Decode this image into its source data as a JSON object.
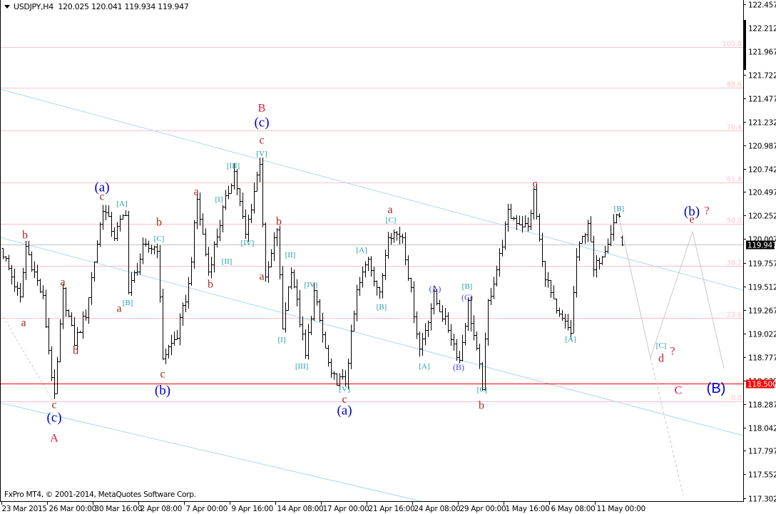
{
  "header": {
    "symbol": "USDJPY,H4",
    "open": "120.025",
    "high": "120.041",
    "low": "119.934",
    "close": "119.947"
  },
  "footer": {
    "copyright": "FxPro MT4, © 2001-2014, MetaQuotes Software Corp."
  },
  "colors": {
    "bars": "#000000",
    "fib": "#ffc0cb",
    "channel": "#add8e6",
    "hline": "#ff0000",
    "projection": "#c8c8c8",
    "wave_minor": "#a52a2a",
    "wave_bracket": "#20a0a0",
    "wave_paren": "#0000cd",
    "wave_major": "#dc143c",
    "wave_small_paren": "#4040ff"
  },
  "chart_data": {
    "type": "ohlc",
    "title": "USDJPY,H4",
    "ylim": [
      117.302,
      122.457
    ],
    "y_ticks": [
      "122.457",
      "122.212",
      "121.967",
      "121.722",
      "121.477",
      "121.232",
      "120.987",
      "120.742",
      "120.497",
      "120.252",
      "120.007",
      "119.757",
      "119.512",
      "119.267",
      "119.022",
      "118.777",
      "118.532",
      "118.287",
      "118.042",
      "117.797",
      "117.552",
      "117.302"
    ],
    "x_ticks": [
      "23 Mar 2015",
      "26 Mar 00:00",
      "30 Mar 16:00",
      "2 Apr 08:00",
      "7 Apr 00:00",
      "9 Apr 16:00",
      "14 Apr 08:00",
      "17 Apr 00:00",
      "21 Apr 16:00",
      "24 Apr 08:00",
      "29 Apr 00:00",
      "1 May 16:00",
      "6 May 08:00",
      "11 May 00:00"
    ],
    "bars_per_x_tick": 16,
    "swing_points": [
      [
        0,
        119.861
      ],
      [
        6,
        119.377
      ],
      [
        8,
        119.935
      ],
      [
        14,
        119.377
      ],
      [
        18,
        118.336
      ],
      [
        21,
        119.452
      ],
      [
        25,
        118.931
      ],
      [
        29,
        119.229
      ],
      [
        35,
        120.344
      ],
      [
        39,
        120.047
      ],
      [
        43,
        120.307
      ],
      [
        44,
        119.452
      ],
      [
        49,
        119.898
      ],
      [
        54,
        119.935
      ],
      [
        56,
        118.782
      ],
      [
        61,
        119.005
      ],
      [
        65,
        119.526
      ],
      [
        68,
        120.419
      ],
      [
        72,
        119.675
      ],
      [
        77,
        120.307
      ],
      [
        81,
        120.716
      ],
      [
        85,
        120.047
      ],
      [
        90,
        120.828
      ],
      [
        92,
        119.563
      ],
      [
        96,
        120.121
      ],
      [
        98,
        119.08
      ],
      [
        101,
        119.712
      ],
      [
        106,
        118.782
      ],
      [
        109,
        119.452
      ],
      [
        115,
        118.559
      ],
      [
        120,
        118.522
      ],
      [
        124,
        119.452
      ],
      [
        128,
        119.824
      ],
      [
        132,
        119.414
      ],
      [
        135,
        120.084
      ],
      [
        140,
        120.047
      ],
      [
        146,
        118.857
      ],
      [
        151,
        119.414
      ],
      [
        156,
        119.08
      ],
      [
        160,
        118.745
      ],
      [
        163,
        119.34
      ],
      [
        168,
        118.485
      ],
      [
        170,
        119.34
      ],
      [
        174,
        119.824
      ],
      [
        177,
        120.27
      ],
      [
        184,
        120.121
      ],
      [
        186,
        120.493
      ],
      [
        189,
        119.749
      ],
      [
        194,
        119.229
      ],
      [
        199,
        119.043
      ],
      [
        201,
        119.824
      ],
      [
        205,
        120.196
      ],
      [
        207,
        119.675
      ],
      [
        211,
        119.935
      ],
      [
        215,
        120.255
      ]
    ],
    "last_bar": {
      "open": 120.025,
      "high": 120.041,
      "low": 119.934,
      "close": 119.947
    },
    "current_price_label": "119.947",
    "horizontal_line": {
      "price": 118.5,
      "label": "118.500"
    },
    "fibonacci": {
      "price_0": 118.314,
      "price_100": 122.011,
      "levels": [
        "100.0",
        "88.6",
        "76.4",
        "61.8",
        "50.0",
        "38.2",
        "23.6",
        "0.0"
      ]
    },
    "projection_path": [
      [
        215.75,
        120.255
      ],
      [
        227,
        118.767
      ],
      [
        241.75,
        120.084
      ],
      [
        252.75,
        118.656
      ]
    ],
    "projection_dashed": [
      [
        227,
        118.767
      ],
      [
        238.5,
        117.332
      ]
    ],
    "annotations": [
      {
        "text": "a",
        "style": "minor",
        "bar": 7.25,
        "price": 119.139
      },
      {
        "text": "b",
        "style": "minor",
        "bar": 7.75,
        "price": 120.054
      },
      {
        "text": "a",
        "style": "minor",
        "bar": 21,
        "price": 119.563
      },
      {
        "text": "b",
        "style": "minor",
        "bar": 25.5,
        "price": 118.849
      },
      {
        "text": "c",
        "style": "minor",
        "bar": 18,
        "price": 118.284
      },
      {
        "text": "(c)",
        "style": "paren",
        "bar": 18,
        "price": 118.15
      },
      {
        "text": "A",
        "style": "major",
        "bar": 18,
        "price": 117.934
      },
      {
        "text": "(a)",
        "style": "paren",
        "bar": 34.75,
        "price": 120.553
      },
      {
        "text": "c",
        "style": "minor",
        "bar": 34.75,
        "price": 120.456
      },
      {
        "text": "[A]",
        "style": "bracket",
        "bar": 41.75,
        "price": 120.382
      },
      {
        "text": "a",
        "style": "minor",
        "bar": 40.75,
        "price": 119.288
      },
      {
        "text": "[B]",
        "style": "bracket",
        "bar": 43.75,
        "price": 119.348
      },
      {
        "text": "b",
        "style": "minor",
        "bar": 54.75,
        "price": 120.188
      },
      {
        "text": "[C]",
        "style": "bracket",
        "bar": 54.75,
        "price": 120.017
      },
      {
        "text": "c",
        "style": "minor",
        "bar": 56,
        "price": 118.604
      },
      {
        "text": "(b)",
        "style": "paren",
        "bar": 56,
        "price": 118.433
      },
      {
        "text": "a",
        "style": "minor",
        "bar": 67.75,
        "price": 120.508
      },
      {
        "text": "b",
        "style": "minor",
        "bar": 72.75,
        "price": 119.541
      },
      {
        "text": "[I]",
        "style": "bracket",
        "bar": 75.75,
        "price": 120.426
      },
      {
        "text": "[II]",
        "style": "bracket",
        "bar": 78.5,
        "price": 119.779
      },
      {
        "text": "[III]",
        "style": "bracket",
        "bar": 80.75,
        "price": 120.776
      },
      {
        "text": "[IV]",
        "style": "bracket",
        "bar": 85.75,
        "price": 119.972
      },
      {
        "text": "[V]",
        "style": "bracket",
        "bar": 90.75,
        "price": 120.902
      },
      {
        "text": "c",
        "style": "minor",
        "bar": 90.75,
        "price": 121.044
      },
      {
        "text": "(c)",
        "style": "paren",
        "bar": 90.75,
        "price": 121.23
      },
      {
        "text": "B",
        "style": "major",
        "bar": 90.75,
        "price": 121.378
      },
      {
        "text": "a",
        "style": "minor",
        "bar": 90.75,
        "price": 119.623
      },
      {
        "text": "b",
        "style": "minor",
        "bar": 96.75,
        "price": 120.196
      },
      {
        "text": "[II]",
        "style": "bracket",
        "bar": 100.75,
        "price": 119.846
      },
      {
        "text": "[I]",
        "style": "bracket",
        "bar": 97.75,
        "price": 118.961
      },
      {
        "text": "[IV]",
        "style": "bracket",
        "bar": 108,
        "price": 119.534
      },
      {
        "text": "[III]",
        "style": "bracket",
        "bar": 104.75,
        "price": 118.685
      },
      {
        "text": "[V]",
        "style": "bracket",
        "bar": 119.75,
        "price": 118.447
      },
      {
        "text": "c",
        "style": "minor",
        "bar": 119.75,
        "price": 118.34
      },
      {
        "text": "(a)",
        "style": "paren",
        "bar": 119.75,
        "price": 118.225
      },
      {
        "text": "[A]",
        "style": "bracket",
        "bar": 125.75,
        "price": 119.898
      },
      {
        "text": "[B]",
        "style": "bracket",
        "bar": 132.75,
        "price": 119.303
      },
      {
        "text": "[C]",
        "style": "bracket",
        "bar": 136,
        "price": 120.21
      },
      {
        "text": "a",
        "style": "minor",
        "bar": 135.75,
        "price": 120.32
      },
      {
        "text": "[A]",
        "style": "bracket",
        "bar": 147.75,
        "price": 118.685
      },
      {
        "text": "(A)",
        "style": "smallparen",
        "bar": 151.5,
        "price": 119.489
      },
      {
        "text": "(B)",
        "style": "smallparen",
        "bar": 159.75,
        "price": 118.671
      },
      {
        "text": "[B]",
        "style": "bracket",
        "bar": 162.75,
        "price": 119.519
      },
      {
        "text": "(C)",
        "style": "smallparen",
        "bar": 162.75,
        "price": 119.4
      },
      {
        "text": "[C]",
        "style": "bracket",
        "bar": 168,
        "price": 118.44
      },
      {
        "text": "b",
        "style": "minor",
        "bar": 167.75,
        "price": 118.276
      },
      {
        "text": "c",
        "style": "minor",
        "bar": 186.5,
        "price": 120.59
      },
      {
        "text": "[A]",
        "style": "bracket",
        "bar": 199,
        "price": 118.968
      },
      {
        "text": "[B]",
        "style": "bracket",
        "bar": 216,
        "price": 120.329
      },
      {
        "text": "(b)",
        "style": "paren",
        "bar": 241.5,
        "price": 120.3
      },
      {
        "text": "?",
        "style": "major",
        "bar": 246.75,
        "price": 120.307
      },
      {
        "text": "e",
        "style": "minor",
        "bar": 241.5,
        "price": 120.218
      },
      {
        "text": "[C]",
        "style": "bracket",
        "bar": 230.75,
        "price": 118.901
      },
      {
        "text": "d",
        "style": "minor",
        "bar": 230.75,
        "price": 118.767
      },
      {
        "text": "?",
        "style": "major",
        "bar": 234.75,
        "price": 118.842
      },
      {
        "text": "C",
        "style": "major",
        "bar": 236.75,
        "price": 118.433
      },
      {
        "text": "(B)",
        "style": "bigparen",
        "bar": 250,
        "price": 118.455
      }
    ]
  }
}
